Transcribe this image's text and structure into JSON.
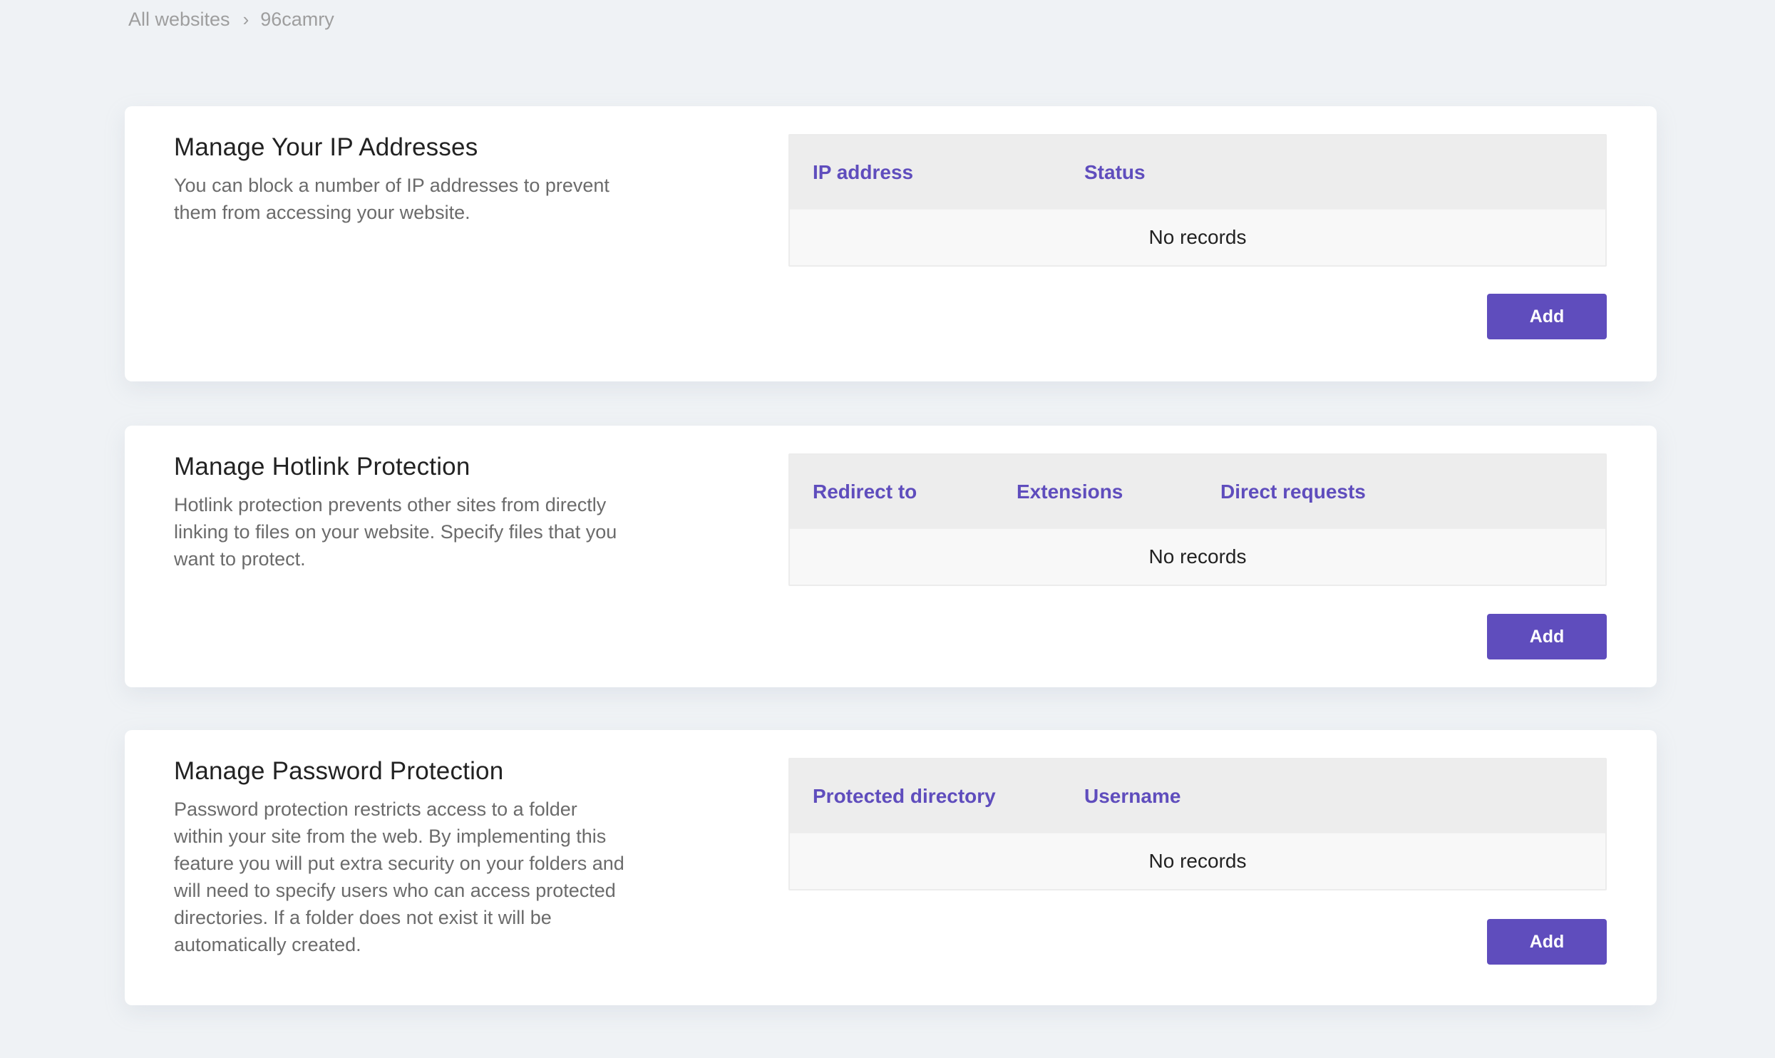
{
  "breadcrumb": {
    "items": [
      {
        "label": "All websites"
      },
      {
        "label": "96camry"
      }
    ],
    "separator": "›"
  },
  "colors": {
    "accent": "#5f4dbd",
    "background": "#eff2f5",
    "table_header_bg": "#ededed",
    "table_body_bg": "#f8f8f8"
  },
  "sections": [
    {
      "title": "Manage Your IP Addresses",
      "description": "You can block a number of IP addresses to prevent them from accessing your website.",
      "columns": [
        "IP address",
        "Status"
      ],
      "empty_text": "No records",
      "add_label": "Add"
    },
    {
      "title": "Manage Hotlink Protection",
      "description": "Hotlink protection prevents other sites from directly linking to files on your website. Specify files that you want to protect.",
      "columns": [
        "Redirect to",
        "Extensions",
        "Direct requests"
      ],
      "empty_text": "No records",
      "add_label": "Add"
    },
    {
      "title": "Manage Password Protection",
      "description": "Password protection restricts access to a folder within your site from the web. By implementing this feature you will put extra security on your folders and will need to specify users who can access protected directories. If a folder does not exist it will be automatically created.",
      "columns": [
        "Protected directory",
        "Username"
      ],
      "empty_text": "No records",
      "add_label": "Add"
    }
  ]
}
